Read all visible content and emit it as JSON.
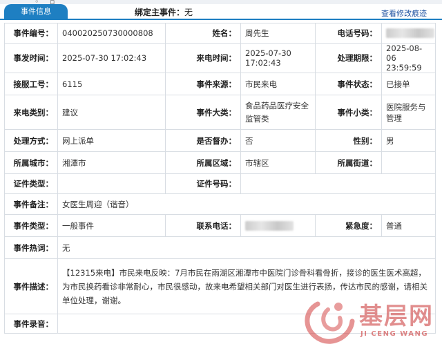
{
  "tab": {
    "label": "事件信息"
  },
  "bind_main": {
    "label": "绑定主事件：",
    "value": "无"
  },
  "view_log": "查看修改痕迹",
  "rows": {
    "r1": {
      "k1": "事件编号：",
      "v1": "040020250730000808",
      "k2": "姓名：",
      "v2": "周先生",
      "k3": "电话号码："
    },
    "r2": {
      "k1": "事发时间：",
      "v1": "2025-07-30 17:02:43",
      "k2": "来电时间：",
      "v2": "2025-07-30 17:02:43",
      "k3": "处理期限：",
      "v3": "2025-08-06 23:59:59"
    },
    "r3": {
      "k1": "接服工号：",
      "v1": "6115",
      "k2": "事件来源：",
      "v2": "市民来电",
      "k3": "事件状态：",
      "v3": "已接单"
    },
    "r4": {
      "k1": "来电类别：",
      "v1": "建议",
      "k2": "事件大类：",
      "v2": "食品药品医疗安全监管类",
      "k3": "事件小类：",
      "v3": "医院服务与管理"
    },
    "r5": {
      "k1": "处理方式：",
      "v1": "网上派单",
      "k2": "是否督办：",
      "v2": "否",
      "k3": "性别：",
      "v3": "男"
    },
    "r6": {
      "k1": "所属城市：",
      "v1": "湘潭市",
      "k2": "所属区域：",
      "v2": "市辖区",
      "k3": "所属街道：",
      "v3": ""
    },
    "r7": {
      "k1": "证件类型：",
      "v1": "",
      "k2": "证件号码：",
      "v2": ""
    },
    "r8": {
      "k1": "事件备注：",
      "v1": "女医生周迎（谐音）"
    },
    "r9": {
      "k1": "事件类型：",
      "v1": "一般事件",
      "k2": "联系电话：",
      "k3": "紧急度：",
      "v3": "普通"
    },
    "r10": {
      "k1": "事件热词：",
      "v1": "无"
    },
    "r11": {
      "k1": "事件描述：",
      "v1": "【12315来电】市民来电反映：7月市民在雨湖区湘潭市中医院门诊骨科看骨折，接诊的医生医术高超，为市民换药看诊非常耐心，市民很感动，故来电希望相关部门对医生进行表扬，传达市民的感谢，请相关单位处理，谢谢。"
    },
    "r12": {
      "k1": "事件录音：",
      "v1": ""
    }
  },
  "watermark": {
    "text": "基层网",
    "sub": "JI CENG WANG"
  },
  "colors": {
    "accent": "#1e7fc2",
    "link": "#1b4fa0",
    "border": "#d8dde3"
  }
}
